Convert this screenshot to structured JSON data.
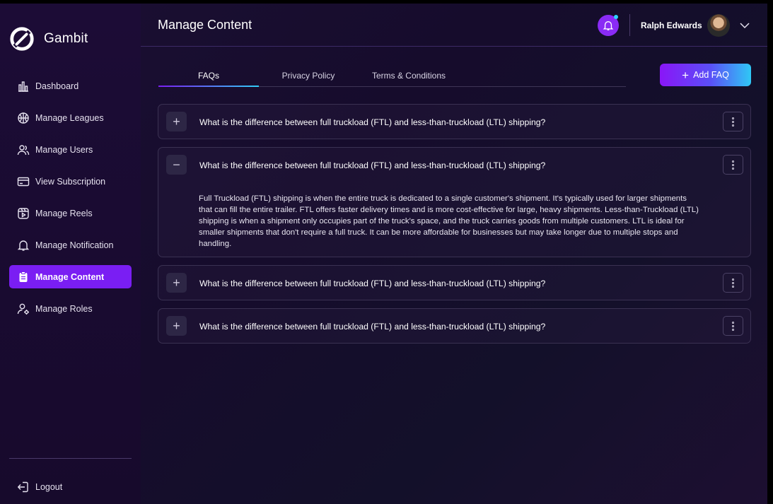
{
  "brand": {
    "name": "Gambit",
    "logo_icon": "gambit-logo-icon"
  },
  "sidebar": {
    "items": [
      {
        "label": "Dashboard",
        "icon": "bar-chart-icon",
        "active": false
      },
      {
        "label": "Manage Leagues",
        "icon": "basketball-icon",
        "active": false
      },
      {
        "label": "Manage Users",
        "icon": "users-icon",
        "active": false
      },
      {
        "label": "View Subscription",
        "icon": "card-icon",
        "active": false
      },
      {
        "label": "Manage Reels",
        "icon": "reels-icon",
        "active": false
      },
      {
        "label": "Manage Notification",
        "icon": "bell-icon",
        "active": false
      },
      {
        "label": "Manage Content",
        "icon": "clipboard-icon",
        "active": true
      },
      {
        "label": "Manage Roles",
        "icon": "user-gear-icon",
        "active": false
      }
    ],
    "logout_label": "Logout"
  },
  "header": {
    "title": "Manage Content",
    "user_name": "Ralph Edwards"
  },
  "tabs": [
    {
      "label": "FAQs",
      "active": true
    },
    {
      "label": "Privacy Policy",
      "active": false
    },
    {
      "label": "Terms & Conditions",
      "active": false
    }
  ],
  "add_button_label": "Add FAQ",
  "faqs": [
    {
      "question": "What is the difference between full truckload (FTL) and less-than-truckload (LTL) shipping?",
      "expanded": false,
      "answer": ""
    },
    {
      "question": "What is the difference between full truckload (FTL) and less-than-truckload (LTL) shipping?",
      "expanded": true,
      "answer": "Full Truckload (FTL) shipping is when the entire truck is dedicated to a single customer's shipment. It's typically used for larger shipments that can fill the entire trailer. FTL offers faster delivery times and is more cost-effective for large, heavy shipments. Less-than-Truckload (LTL) shipping is when a shipment only occupies part of the truck's space, and the truck carries goods from multiple customers. LTL is ideal for smaller shipments that don't require a full truck. It can be more affordable for businesses but may take longer due to multiple stops and handling."
    },
    {
      "question": "What is the difference between full truckload (FTL) and less-than-truckload (LTL) shipping?",
      "expanded": false,
      "answer": ""
    },
    {
      "question": "What is the difference between full truckload (FTL) and less-than-truckload (LTL) shipping?",
      "expanded": false,
      "answer": ""
    }
  ],
  "colors": {
    "accent": "#7a1ef3",
    "accent_cyan": "#2fc8f5",
    "background": "#160c2c"
  }
}
